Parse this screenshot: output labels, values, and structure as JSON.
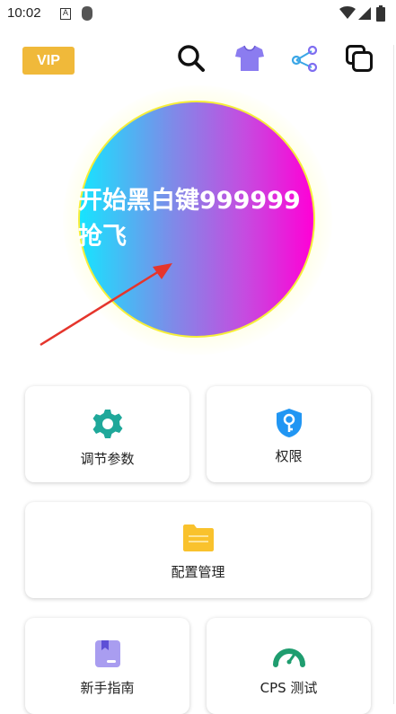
{
  "status": {
    "time": "10:02",
    "a_label": "A"
  },
  "header": {
    "vip_label": "VIP"
  },
  "main": {
    "start_button_label": "开始黑白键999999抢飞"
  },
  "cards": {
    "adjust_params": "调节参数",
    "permissions": "权限",
    "config_manage": "配置管理",
    "new_guide": "新手指南",
    "cps_test": "CPS 测试"
  },
  "colors": {
    "vip": "#f0b93a",
    "gear": "#1fa89a",
    "key": "#2196f3",
    "folder": "#f9c22d",
    "book": "#8d82e6",
    "gauge": "#1f9d6f",
    "arrow": "#e5352c"
  },
  "icons": [
    "search-icon",
    "shirt-icon",
    "share-icon",
    "copy-icon",
    "gear-icon",
    "key-icon",
    "folder-icon",
    "book-icon",
    "gauge-icon"
  ]
}
